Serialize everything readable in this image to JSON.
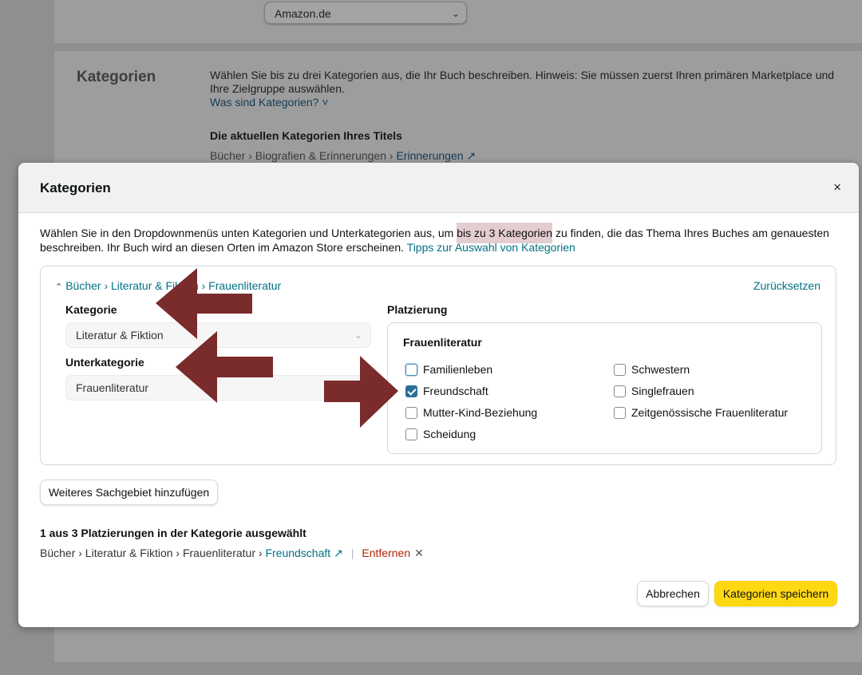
{
  "background": {
    "marketplace_select": "Amazon.de",
    "section_title": "Kategorien",
    "description": "Wählen Sie bis zu drei Kategorien aus, die Ihr Buch beschreiben. Hinweis: Sie müssen zuerst Ihren primären Marketplace und Ihre Zielgruppe auswählen.",
    "help_link": "Was sind Kategorien? ˅",
    "current_heading": "Die aktuellen Kategorien Ihres Titels",
    "current_path": "Bücher › Biografien & Erinnerungen › ",
    "current_link": "Erinnerungen ↗"
  },
  "modal": {
    "title": "Kategorien",
    "close_icon": "×",
    "intro_part1": "Wählen Sie in den Dropdownmenüs unten Kategorien und Unterkategorien aus, um ",
    "intro_highlight": "bis zu 3 Kategorien",
    "intro_part2": " zu finden, die das Thema Ihres Buches am genauesten beschreiben. Ihr Buch wird an diesen Orten im Amazon Store erscheinen. ",
    "intro_link": "Tipps zur Auswahl von Kategorien",
    "crumb": "Bücher › Literatur & Fiktion › Frauenliteratur",
    "reset": "Zurücksetzen",
    "category_label": "Kategorie",
    "category_value": "Literatur & Fiktion",
    "subcategory_label": "Unterkategorie",
    "subcategory_value": "Frauenliteratur",
    "placement_label": "Platzierung",
    "placement_title": "Frauenliteratur",
    "options": [
      {
        "label": "Familienleben",
        "checked": false
      },
      {
        "label": "Freundschaft",
        "checked": true
      },
      {
        "label": "Mutter-Kind-Beziehung",
        "checked": false
      },
      {
        "label": "Scheidung",
        "checked": false
      },
      {
        "label": "Schwestern",
        "checked": false
      },
      {
        "label": "Singlefrauen",
        "checked": false
      },
      {
        "label": "Zeitgenössische Frauenliteratur",
        "checked": false
      }
    ],
    "add_subject_button": "Weiteres Sachgebiet hinzufügen",
    "selected_count": "1 aus 3 Platzierungen in der Kategorie ausgewählt",
    "selected_path": "Bücher › Literatur & Fiktion › Frauenliteratur › ",
    "selected_link": "Freundschaft ↗",
    "remove_label": "Entfernen",
    "remove_icon": "✕",
    "cancel_button": "Abbrechen",
    "save_button": "Kategorien speichern"
  },
  "colors": {
    "link": "#007185",
    "primary_button": "#ffd814",
    "checkbox_checked": "#2b6f97",
    "remove": "#b12704",
    "annotation_arrow": "#7a2b2b"
  }
}
